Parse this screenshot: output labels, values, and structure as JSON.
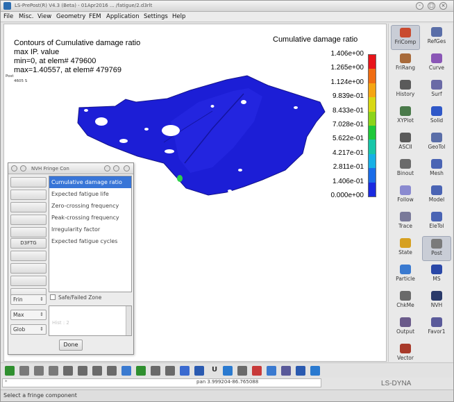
{
  "window": {
    "title": "LS-PrePost(R) V4.3 (Beta) - 01Apr2016 ... /fatigue/2.d3rlt",
    "controls": [
      "-",
      "□",
      "×"
    ]
  },
  "menu": [
    "File",
    "Misc.",
    "View",
    "Geometry",
    "FEM",
    "Application",
    "Settings",
    "Help"
  ],
  "viewport": {
    "contour_title": "Contours of Cumulative damage ratio",
    "contour_lines": [
      "max IP. value",
      "min=0, at elem# 479600",
      "max=1.40557, at elem# 479769"
    ],
    "tree": [
      "Post",
      "4605 S"
    ],
    "legend": {
      "title": "Cumulative damage ratio",
      "values": [
        "1.406e+00",
        "1.265e+00",
        "1.124e+00",
        "9.839e-01",
        "8.433e-01",
        "7.028e-01",
        "5.622e-01",
        "4.217e-01",
        "2.811e-01",
        "1.406e-01",
        "0.000e+00"
      ],
      "colors": [
        "#e8141a",
        "#f06d12",
        "#f5a512",
        "#d8d814",
        "#8cd41a",
        "#1fc83a",
        "#18c6a8",
        "#17b0e6",
        "#1a6ce8",
        "#1a2ae0"
      ]
    },
    "part_color": "#1c1ed6"
  },
  "right_panel": {
    "buttons": [
      {
        "label": "FriComp",
        "icon": "fringe-component-icon",
        "color": "#c94a2f"
      },
      {
        "label": "RefGes",
        "icon": "ref-geometry-icon",
        "color": "#5a6ea8"
      },
      {
        "label": "FriRang",
        "icon": "fringe-range-icon",
        "color": "#a86a3a"
      },
      {
        "label": "Curve",
        "icon": "curve-icon",
        "color": "#8a56b6"
      },
      {
        "label": "History",
        "icon": "history-icon",
        "color": "#5a5a5a"
      },
      {
        "label": "Surf",
        "icon": "surface-icon",
        "color": "#6a6aa6"
      },
      {
        "label": "XYPlot",
        "icon": "xyplot-icon",
        "color": "#4a7a4a"
      },
      {
        "label": "Solid",
        "icon": "solid-icon",
        "color": "#2f58c8"
      },
      {
        "label": "ASCII",
        "icon": "ascii-icon",
        "color": "#5a5a5a"
      },
      {
        "label": "GeoTol",
        "icon": "geotol-icon",
        "color": "#5a6ea8"
      },
      {
        "label": "Binout",
        "icon": "binout-icon",
        "color": "#6a6a6a"
      },
      {
        "label": "Mesh",
        "icon": "mesh-icon",
        "color": "#4a64b4"
      },
      {
        "label": "Follow",
        "icon": "follow-icon",
        "color": "#8a8ad0"
      },
      {
        "label": "Model",
        "icon": "model-icon",
        "color": "#4a64b4"
      },
      {
        "label": "Trace",
        "icon": "trace-icon",
        "color": "#7a7a9a"
      },
      {
        "label": "EleTol",
        "icon": "eletol-icon",
        "color": "#4a64b4"
      },
      {
        "label": "State",
        "icon": "state-icon",
        "color": "#d6a020"
      },
      {
        "label": "Post",
        "icon": "post-icon",
        "color": "#7a7a7a"
      },
      {
        "label": "Particle",
        "icon": "particle-icon",
        "color": "#3a7ad0"
      },
      {
        "label": "MS",
        "icon": "ms-icon",
        "color": "#2a48a8"
      },
      {
        "label": "ChkMe",
        "icon": "check-icon",
        "color": "#6a6a6a"
      },
      {
        "label": "NVH",
        "icon": "nvh-icon",
        "color": "#2a3a6a"
      },
      {
        "label": "Output",
        "icon": "output-icon",
        "color": "#6a5a8a"
      },
      {
        "label": "Favor1",
        "icon": "favorite-icon",
        "color": "#5a5a9a"
      },
      {
        "label": "Vector",
        "icon": "vector-icon",
        "color": "#a83a2a"
      }
    ]
  },
  "dialog": {
    "title": "NVH Fringe Con",
    "left_buttons": [
      "",
      "",
      "",
      "",
      "",
      "D3FTG",
      "",
      "",
      "",
      ""
    ],
    "list": [
      "Cumulative damage ratio",
      "Expected fatigue life",
      "Zero-crossing frequency",
      "Peak-crossing frequency",
      "Irregularity factor",
      "Expected fatigue cycles"
    ],
    "selected_index": 0,
    "combos": [
      "Frin",
      "Max",
      "Glob"
    ],
    "safe_failed_label": "Safe/Failed Zone",
    "textarea_placeholder": "Hist : 2",
    "done_label": "Done"
  },
  "toolbar": {
    "colors": [
      "#2f8f2f",
      "#7a7a7a",
      "#7a7a7a",
      "#7a7a7a",
      "#6a6a6a",
      "#6a6a6a",
      "#6a6a6a",
      "#6a6a6a",
      "#3a7ad0",
      "#2f8f2f",
      "#6a6a6a",
      "#6a6a6a",
      "#3a6ad0",
      "#2a5ab0",
      "#2a7ad0",
      "#6a6a6a",
      "#c83a3a",
      "#3a7ad0",
      "#5a5a9a",
      "#2a5ab0",
      "#2a7ad0"
    ],
    "u_label": "U"
  },
  "command_placeholder": "*",
  "coordinates": "pan 3.999204-86.765088",
  "status_text": "Select a fringe component",
  "watermark": "LS-DYNA"
}
